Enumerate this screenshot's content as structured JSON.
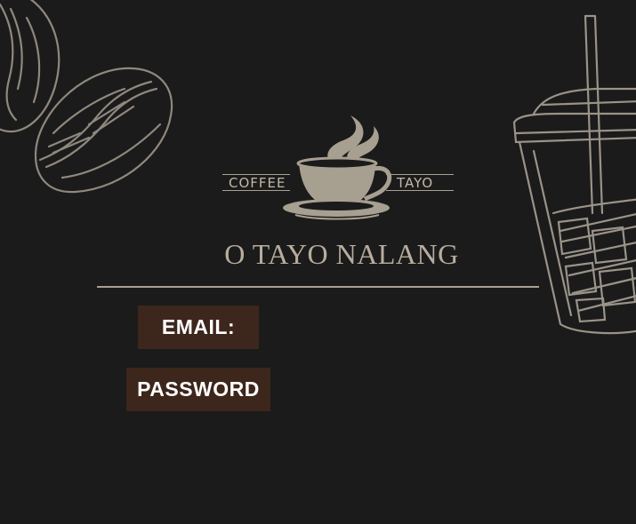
{
  "logo": {
    "left_word": "COFFEE",
    "right_word": "TAYO",
    "icon": "coffee-cup-icon"
  },
  "tagline": "O TAYO NALANG",
  "form": {
    "email_label": "EMAIL:",
    "password_label": "PASSWORD"
  },
  "decorations": [
    "coffee-beans-illustration",
    "iced-coffee-cup-illustration"
  ],
  "colors": {
    "background": "#1b1b1b",
    "accent_text": "#b7ad9d",
    "button_bg": "#3d261c",
    "button_text": "#ffffff"
  }
}
